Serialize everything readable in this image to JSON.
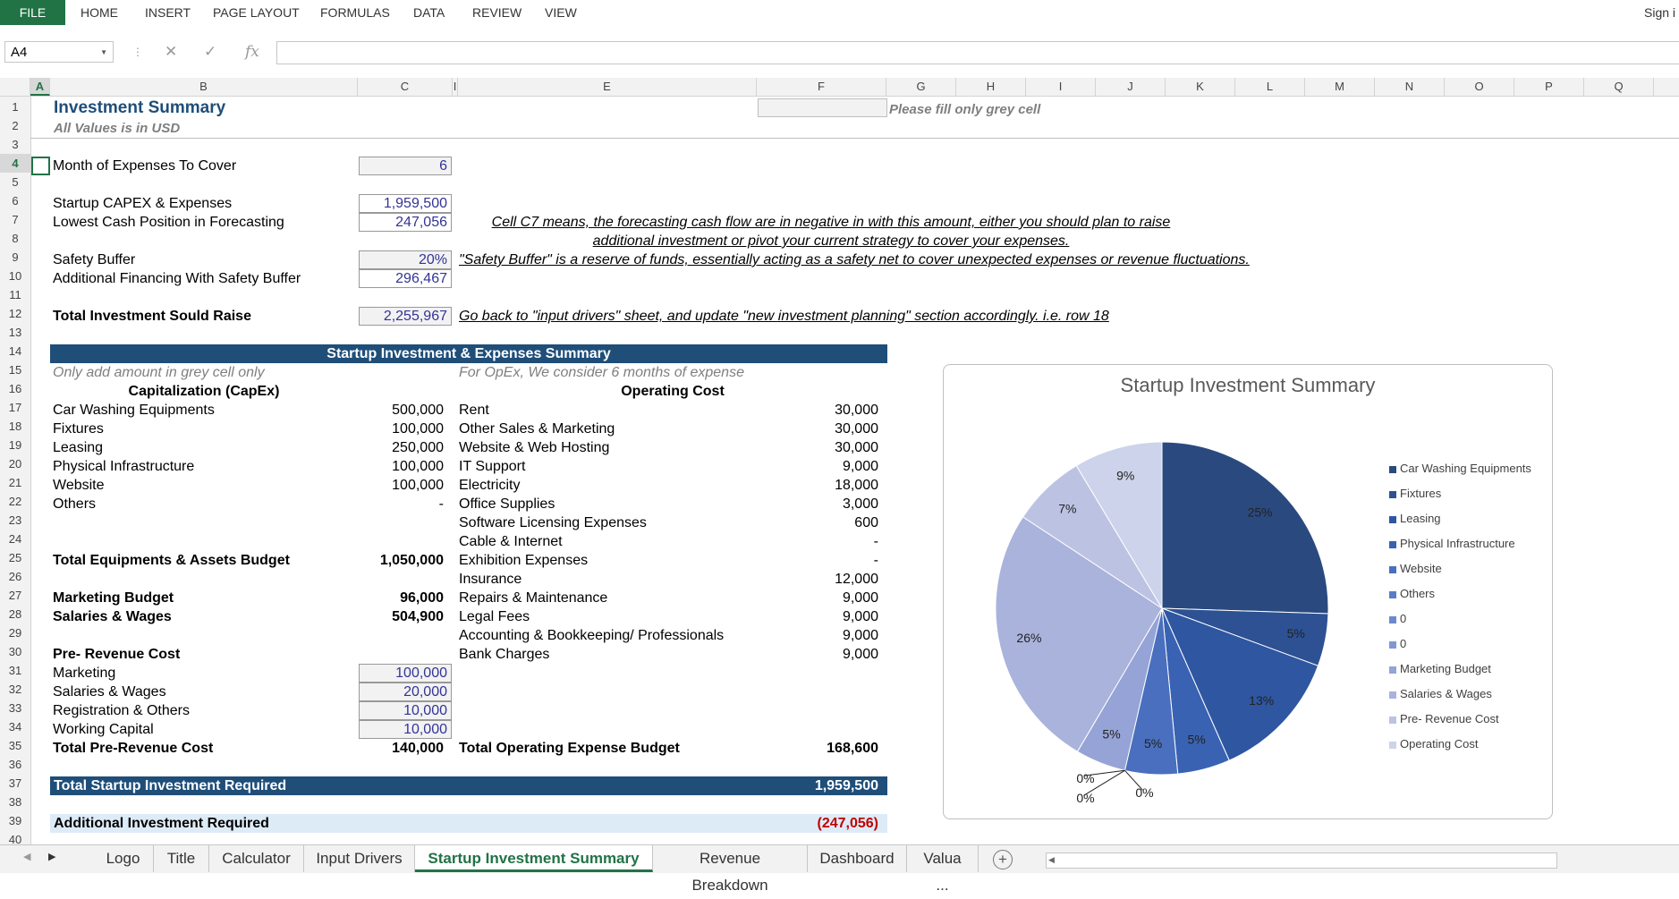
{
  "ribbon": {
    "file": "FILE",
    "tabs": [
      "HOME",
      "INSERT",
      "PAGE LAYOUT",
      "FORMULAS",
      "DATA",
      "REVIEW",
      "VIEW"
    ],
    "sign_in": "Sign i"
  },
  "formula_bar": {
    "name_box": "A4",
    "formula": ""
  },
  "columns": [
    "A",
    "B",
    "C",
    "I",
    "E",
    "F",
    "G",
    "H",
    "I",
    "J",
    "K",
    "L",
    "M",
    "N",
    "O",
    "P",
    "Q"
  ],
  "rows": [
    "1",
    "2",
    "3",
    "4",
    "5",
    "6",
    "7",
    "8",
    "9",
    "10",
    "11",
    "12",
    "13",
    "14",
    "15",
    "16",
    "17",
    "18",
    "19",
    "20",
    "21",
    "22",
    "23",
    "24",
    "25",
    "26",
    "27",
    "28",
    "29",
    "30",
    "31",
    "32",
    "33",
    "34",
    "35",
    "36",
    "37",
    "38",
    "39",
    "40"
  ],
  "sheet": {
    "title": "Investment Summary",
    "subtitle": "All Values is in USD",
    "fill_note": "Please fill only grey cell",
    "month_label": "Month of Expenses To Cover",
    "month_value": "6",
    "capex_label": "Startup CAPEX & Expenses",
    "capex_value": "1,959,500",
    "lowest_label": "Lowest Cash Position in Forecasting",
    "lowest_value": "247,056",
    "note_c7_line1": "Cell C7 means, the forecasting cash flow are in negative in with this amount, either you should plan to raise",
    "note_c7_line2": "additional investment or pivot your current strategy to cover your expenses.",
    "safety_label": "Safety Buffer",
    "safety_value": "20%",
    "safety_note": "\"Safety Buffer\" is a reserve of funds, essentially acting as a safety net to cover unexpected expenses or revenue fluctuations.",
    "addfin_label": "Additional Financing With Safety Buffer",
    "addfin_value": "296,467",
    "total_raise_label": "Total Investment Sould Raise",
    "total_raise_value": "2,255,967",
    "total_raise_note": "Go back to \"input drivers\" sheet, and update \"new investment planning\" section accordingly. i.e. row 18",
    "summary_banner": "Startup Investment & Expenses Summary",
    "capex_hint": "Only add amount in grey cell only",
    "opex_hint": "For OpEx, We consider 6 months of expense",
    "capex_header": "Capitalization (CapEx)",
    "opex_header": "Operating Cost",
    "capex_items": [
      {
        "label": "Car Washing Equipments",
        "value": "500,000"
      },
      {
        "label": "Fixtures",
        "value": "100,000"
      },
      {
        "label": "Leasing",
        "value": "250,000"
      },
      {
        "label": "Physical Infrastructure",
        "value": "100,000"
      },
      {
        "label": "Website",
        "value": "100,000"
      },
      {
        "label": "Others",
        "value": "-"
      }
    ],
    "opex_items": [
      {
        "label": "Rent",
        "value": "30,000"
      },
      {
        "label": "Other Sales & Marketing",
        "value": "30,000"
      },
      {
        "label": "Website & Web Hosting",
        "value": "30,000"
      },
      {
        "label": "IT Support",
        "value": "9,000"
      },
      {
        "label": "Electricity",
        "value": "18,000"
      },
      {
        "label": "Office Supplies",
        "value": "3,000"
      },
      {
        "label": "Software Licensing Expenses",
        "value": "600"
      },
      {
        "label": "Cable & Internet",
        "value": "-"
      },
      {
        "label": "Exhibition Expenses",
        "value": "-"
      },
      {
        "label": "Insurance",
        "value": "12,000"
      },
      {
        "label": "Repairs & Maintenance",
        "value": "9,000"
      },
      {
        "label": "Legal Fees",
        "value": "9,000"
      },
      {
        "label": "Accounting & Bookkeeping/ Professionals",
        "value": "9,000"
      },
      {
        "label": "Bank Charges",
        "value": "9,000"
      }
    ],
    "total_equip_label": "Total Equipments & Assets Budget",
    "total_equip_value": "1,050,000",
    "marketing_label": "Marketing Budget",
    "marketing_value": "96,000",
    "salaries_label": "Salaries & Wages",
    "salaries_value": "504,900",
    "prerev_header": "Pre- Revenue Cost",
    "prerev_items": [
      {
        "label": "Marketing",
        "value": "100,000"
      },
      {
        "label": "Salaries & Wages",
        "value": "20,000"
      },
      {
        "label": "Registration & Others",
        "value": "10,000"
      },
      {
        "label": "Working Capital",
        "value": "10,000"
      }
    ],
    "total_prerev_label": "Total Pre-Revenue Cost",
    "total_prerev_value": "140,000",
    "total_opex_label": "Total Operating Expense Budget",
    "total_opex_value": "168,600",
    "total_startup_label": "Total Startup Investment Required",
    "total_startup_value": "1,959,500",
    "additional_label": "Additional Investment Required",
    "additional_value": "(247,056)"
  },
  "chart_data": {
    "type": "pie",
    "title": "Startup Investment Summary",
    "categories": [
      "Car Washing Equipments",
      "Fixtures",
      "Leasing",
      "Physical Infrastructure",
      "Website",
      "Others",
      "0",
      "0",
      "Marketing Budget",
      "Salaries & Wages",
      "Pre- Revenue Cost",
      "Operating Cost"
    ],
    "values": [
      500000,
      100000,
      250000,
      100000,
      100000,
      0,
      0,
      0,
      96000,
      504900,
      140000,
      168600
    ],
    "labels": [
      "25%",
      "5%",
      "13%",
      "5%",
      "5%",
      "0%",
      "0%",
      "0%",
      "5%",
      "26%",
      "7%",
      "9%"
    ],
    "colors": [
      "#2a4a7f",
      "#2d5193",
      "#2f56a0",
      "#3962b3",
      "#4a6fbe",
      "#5a7cc6",
      "#6d89cd",
      "#8196d2",
      "#95a3d6",
      "#a9b3dc",
      "#bcc3e2",
      "#cdd3ea"
    ],
    "legend": "right"
  },
  "sheet_tabs": [
    "Logo",
    "Title",
    "Calculator",
    "Input Drivers",
    "Startup Investment Summary",
    "Revenue Breakdown",
    "Dashboard",
    "Valua ..."
  ],
  "active_tab": "Startup Investment Summary"
}
